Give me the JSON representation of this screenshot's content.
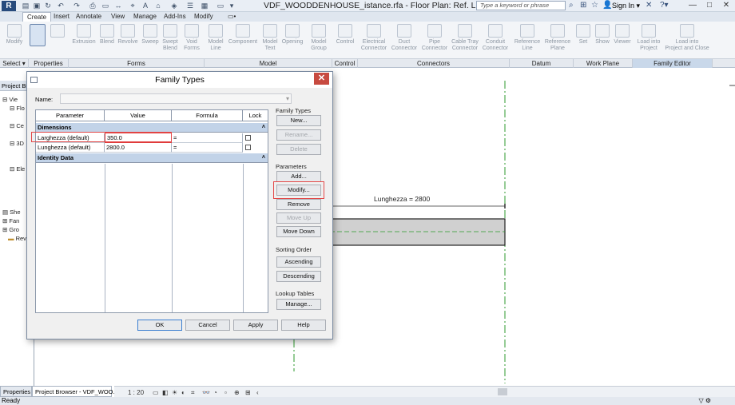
{
  "title_bar": {
    "doc_title": "VDF_WOODDENHOUSE_istance.rfa - Floor Plan: Ref. Level",
    "search_placeholder": "Type a keyword or phrase",
    "sign_in": "Sign In"
  },
  "ribbon_tabs": [
    "Create",
    "Insert",
    "Annotate",
    "View",
    "Manage",
    "Add-Ins",
    "Modify"
  ],
  "ribbon": {
    "buttons": [
      {
        "label": "Modify"
      },
      {
        "label": ""
      },
      {
        "label": "Extrusion"
      },
      {
        "label": "Blend"
      },
      {
        "label": "Revolve"
      },
      {
        "label": "Sweep"
      },
      {
        "label": "Swept\nBlend"
      },
      {
        "label": "Void\nForms"
      },
      {
        "label": "Model\nLine"
      },
      {
        "label": "Component"
      },
      {
        "label": "Model\nText"
      },
      {
        "label": "Opening"
      },
      {
        "label": "Model\nGroup"
      },
      {
        "label": "Control"
      },
      {
        "label": "Electrical\nConnector"
      },
      {
        "label": "Duct\nConnector"
      },
      {
        "label": "Pipe\nConnector"
      },
      {
        "label": "Cable Tray\nConnector"
      },
      {
        "label": "Conduit\nConnector"
      },
      {
        "label": "Reference\nLine"
      },
      {
        "label": "Reference\nPlane"
      },
      {
        "label": "Set"
      },
      {
        "label": "Show"
      },
      {
        "label": "Viewer"
      },
      {
        "label": "Load into\nProject"
      },
      {
        "label": "Load into\nProject and Close"
      }
    ],
    "panels": [
      "Select",
      "Properties",
      "Forms",
      "Model",
      "Control",
      "Connectors",
      "Datum",
      "Work Plane",
      "Family Editor"
    ]
  },
  "project_browser": {
    "title": "Project Bro",
    "items": [
      "Vie",
      "Flo",
      "Ce",
      "3D",
      "Ele",
      "She",
      "Fan",
      "Gro",
      "Rev"
    ]
  },
  "bottom_tabs": [
    "Properties",
    "Project Browser - VDF_WOO..."
  ],
  "view_bar": {
    "scale": "1 : 20"
  },
  "status": "Ready",
  "canvas": {
    "dimension_label": "Lunghezza = 2800"
  },
  "dialog": {
    "title": "Family Types",
    "name_label": "Name:",
    "columns": [
      "Parameter",
      "Value",
      "Formula",
      "Lock"
    ],
    "groups": [
      {
        "name": "Dimensions",
        "rows": [
          {
            "parameter": "Larghezza (default)",
            "value": "350.0",
            "formula": "=",
            "locked": false
          },
          {
            "parameter": "Lunghezza (default)",
            "value": "2800.0",
            "formula": "=",
            "locked": false
          }
        ]
      },
      {
        "name": "Identity Data",
        "rows": []
      }
    ],
    "family_types": {
      "label": "Family Types",
      "new": "New...",
      "rename": "Rename...",
      "delete": "Delete"
    },
    "parameters": {
      "label": "Parameters",
      "add": "Add...",
      "modify": "Modify...",
      "remove": "Remove",
      "move_up": "Move Up",
      "move_down": "Move Down"
    },
    "sorting": {
      "label": "Sorting Order",
      "ascending": "Ascending",
      "descending": "Descending"
    },
    "lookup": {
      "label": "Lookup Tables",
      "manage": "Manage..."
    },
    "footer": {
      "ok": "OK",
      "cancel": "Cancel",
      "apply": "Apply",
      "help": "Help"
    }
  },
  "colors": {
    "accent": "#274a7c",
    "highlight": "#e34848",
    "group_header": "#c2d3e8",
    "close": "#c74a40"
  }
}
